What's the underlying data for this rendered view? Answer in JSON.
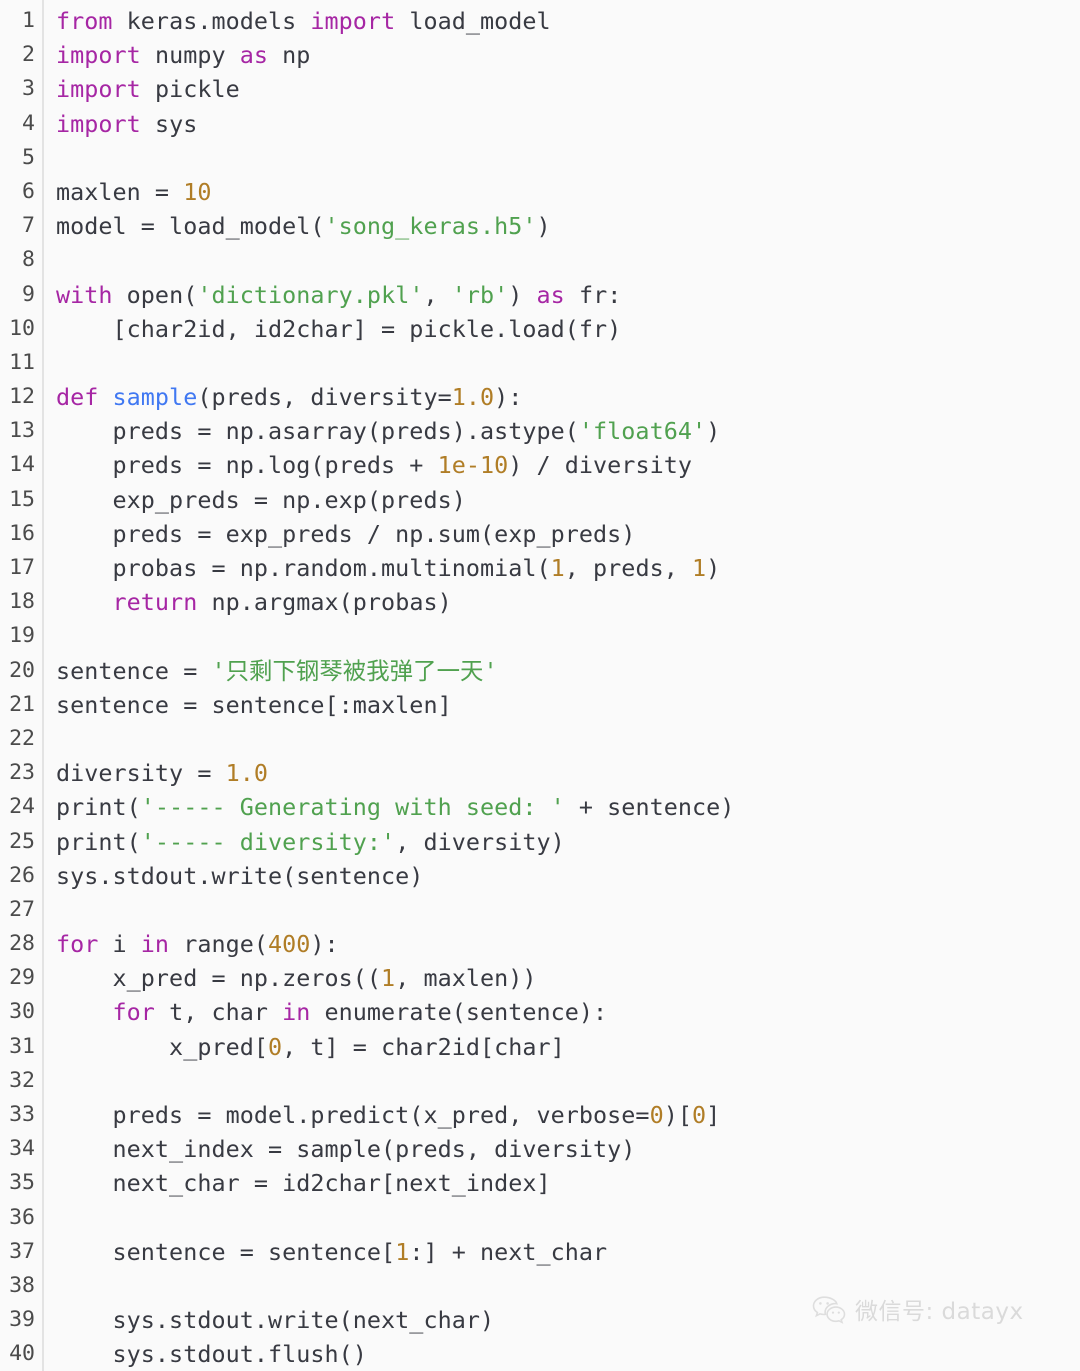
{
  "editor": {
    "language": "python",
    "background_color": "#fafafa",
    "gutter_color": "#4b4b4b",
    "text_color": "#383a42",
    "keyword_color": "#a626a4",
    "string_color": "#50a14f",
    "number_color": "#b07d26",
    "function_color": "#4078f2",
    "first_line_number": 1,
    "last_line_number": 40,
    "line_numbers": [
      "1",
      "2",
      "3",
      "4",
      "5",
      "6",
      "7",
      "8",
      "9",
      "10",
      "11",
      "12",
      "13",
      "14",
      "15",
      "16",
      "17",
      "18",
      "19",
      "20",
      "21",
      "22",
      "23",
      "24",
      "25",
      "26",
      "27",
      "28",
      "29",
      "30",
      "31",
      "32",
      "33",
      "34",
      "35",
      "36",
      "37",
      "38",
      "39",
      "40"
    ],
    "lines": [
      {
        "n": "1",
        "tokens": [
          {
            "t": "from ",
            "c": "kw"
          },
          {
            "t": "keras.models ",
            "c": "pl"
          },
          {
            "t": "import ",
            "c": "kw"
          },
          {
            "t": "load_model",
            "c": "pl"
          }
        ]
      },
      {
        "n": "2",
        "tokens": [
          {
            "t": "import ",
            "c": "kw"
          },
          {
            "t": "numpy ",
            "c": "pl"
          },
          {
            "t": "as ",
            "c": "kw"
          },
          {
            "t": "np",
            "c": "pl"
          }
        ]
      },
      {
        "n": "3",
        "tokens": [
          {
            "t": "import ",
            "c": "kw"
          },
          {
            "t": "pickle",
            "c": "pl"
          }
        ]
      },
      {
        "n": "4",
        "tokens": [
          {
            "t": "import ",
            "c": "kw"
          },
          {
            "t": "sys",
            "c": "pl"
          }
        ]
      },
      {
        "n": "5",
        "tokens": [
          {
            "t": "",
            "c": "pl"
          }
        ]
      },
      {
        "n": "6",
        "tokens": [
          {
            "t": "maxlen = ",
            "c": "pl"
          },
          {
            "t": "10",
            "c": "num"
          }
        ]
      },
      {
        "n": "7",
        "tokens": [
          {
            "t": "model = load_model(",
            "c": "pl"
          },
          {
            "t": "'song_keras.h5'",
            "c": "str"
          },
          {
            "t": ")",
            "c": "pl"
          }
        ]
      },
      {
        "n": "8",
        "tokens": [
          {
            "t": "",
            "c": "pl"
          }
        ]
      },
      {
        "n": "9",
        "tokens": [
          {
            "t": "with ",
            "c": "kw"
          },
          {
            "t": "open(",
            "c": "pl"
          },
          {
            "t": "'dictionary.pkl'",
            "c": "str"
          },
          {
            "t": ", ",
            "c": "pl"
          },
          {
            "t": "'rb'",
            "c": "str"
          },
          {
            "t": ") ",
            "c": "pl"
          },
          {
            "t": "as ",
            "c": "kw"
          },
          {
            "t": "fr:",
            "c": "pl"
          }
        ]
      },
      {
        "n": "10",
        "tokens": [
          {
            "t": "    [char2id, id2char] = pickle.load(fr)",
            "c": "pl"
          }
        ]
      },
      {
        "n": "11",
        "tokens": [
          {
            "t": "",
            "c": "pl"
          }
        ]
      },
      {
        "n": "12",
        "tokens": [
          {
            "t": "def ",
            "c": "kw"
          },
          {
            "t": "sample",
            "c": "fn"
          },
          {
            "t": "(preds, diversity=",
            "c": "pl"
          },
          {
            "t": "1.0",
            "c": "num"
          },
          {
            "t": "):",
            "c": "pl"
          }
        ]
      },
      {
        "n": "13",
        "tokens": [
          {
            "t": "    preds = np.asarray(preds).astype(",
            "c": "pl"
          },
          {
            "t": "'float64'",
            "c": "str"
          },
          {
            "t": ")",
            "c": "pl"
          }
        ]
      },
      {
        "n": "14",
        "tokens": [
          {
            "t": "    preds = np.log(preds + ",
            "c": "pl"
          },
          {
            "t": "1e-10",
            "c": "num"
          },
          {
            "t": ") / diversity",
            "c": "pl"
          }
        ]
      },
      {
        "n": "15",
        "tokens": [
          {
            "t": "    exp_preds = np.exp(preds)",
            "c": "pl"
          }
        ]
      },
      {
        "n": "16",
        "tokens": [
          {
            "t": "    preds = exp_preds / np.sum(exp_preds)",
            "c": "pl"
          }
        ]
      },
      {
        "n": "17",
        "tokens": [
          {
            "t": "    probas = np.random.multinomial(",
            "c": "pl"
          },
          {
            "t": "1",
            "c": "num"
          },
          {
            "t": ", preds, ",
            "c": "pl"
          },
          {
            "t": "1",
            "c": "num"
          },
          {
            "t": ")",
            "c": "pl"
          }
        ]
      },
      {
        "n": "18",
        "tokens": [
          {
            "t": "    ",
            "c": "pl"
          },
          {
            "t": "return ",
            "c": "kw"
          },
          {
            "t": "np.argmax(probas)",
            "c": "pl"
          }
        ]
      },
      {
        "n": "19",
        "tokens": [
          {
            "t": "",
            "c": "pl"
          }
        ]
      },
      {
        "n": "20",
        "tokens": [
          {
            "t": "sentence = ",
            "c": "pl"
          },
          {
            "t": "'只剩下钢琴被我弹了一天'",
            "c": "str"
          }
        ]
      },
      {
        "n": "21",
        "tokens": [
          {
            "t": "sentence = sentence[:maxlen]",
            "c": "pl"
          }
        ]
      },
      {
        "n": "22",
        "tokens": [
          {
            "t": "",
            "c": "pl"
          }
        ]
      },
      {
        "n": "23",
        "tokens": [
          {
            "t": "diversity = ",
            "c": "pl"
          },
          {
            "t": "1.0",
            "c": "num"
          }
        ]
      },
      {
        "n": "24",
        "tokens": [
          {
            "t": "print(",
            "c": "pl"
          },
          {
            "t": "'----- Generating with seed: '",
            "c": "str"
          },
          {
            "t": " + sentence)",
            "c": "pl"
          }
        ]
      },
      {
        "n": "25",
        "tokens": [
          {
            "t": "print(",
            "c": "pl"
          },
          {
            "t": "'----- diversity:'",
            "c": "str"
          },
          {
            "t": ", diversity)",
            "c": "pl"
          }
        ]
      },
      {
        "n": "26",
        "tokens": [
          {
            "t": "sys.stdout.write(sentence)",
            "c": "pl"
          }
        ]
      },
      {
        "n": "27",
        "tokens": [
          {
            "t": "",
            "c": "pl"
          }
        ]
      },
      {
        "n": "28",
        "tokens": [
          {
            "t": "for ",
            "c": "kw"
          },
          {
            "t": "i ",
            "c": "pl"
          },
          {
            "t": "in ",
            "c": "kw"
          },
          {
            "t": "range(",
            "c": "pl"
          },
          {
            "t": "400",
            "c": "num"
          },
          {
            "t": "):",
            "c": "pl"
          }
        ]
      },
      {
        "n": "29",
        "tokens": [
          {
            "t": "    x_pred = np.zeros((",
            "c": "pl"
          },
          {
            "t": "1",
            "c": "num"
          },
          {
            "t": ", maxlen))",
            "c": "pl"
          }
        ]
      },
      {
        "n": "30",
        "tokens": [
          {
            "t": "    ",
            "c": "pl"
          },
          {
            "t": "for ",
            "c": "kw"
          },
          {
            "t": "t, char ",
            "c": "pl"
          },
          {
            "t": "in ",
            "c": "kw"
          },
          {
            "t": "enumerate(sentence):",
            "c": "pl"
          }
        ]
      },
      {
        "n": "31",
        "tokens": [
          {
            "t": "        x_pred[",
            "c": "pl"
          },
          {
            "t": "0",
            "c": "num"
          },
          {
            "t": ", t] = char2id[char]",
            "c": "pl"
          }
        ]
      },
      {
        "n": "32",
        "tokens": [
          {
            "t": "",
            "c": "pl"
          }
        ]
      },
      {
        "n": "33",
        "tokens": [
          {
            "t": "    preds = model.predict(x_pred, verbose=",
            "c": "pl"
          },
          {
            "t": "0",
            "c": "num"
          },
          {
            "t": ")[",
            "c": "pl"
          },
          {
            "t": "0",
            "c": "num"
          },
          {
            "t": "]",
            "c": "pl"
          }
        ]
      },
      {
        "n": "34",
        "tokens": [
          {
            "t": "    next_index = sample(preds, diversity)",
            "c": "pl"
          }
        ]
      },
      {
        "n": "35",
        "tokens": [
          {
            "t": "    next_char = id2char[next_index]",
            "c": "pl"
          }
        ]
      },
      {
        "n": "36",
        "tokens": [
          {
            "t": "",
            "c": "pl"
          }
        ]
      },
      {
        "n": "37",
        "tokens": [
          {
            "t": "    sentence = sentence[",
            "c": "pl"
          },
          {
            "t": "1",
            "c": "num"
          },
          {
            "t": ":] + next_char",
            "c": "pl"
          }
        ]
      },
      {
        "n": "38",
        "tokens": [
          {
            "t": "",
            "c": "pl"
          }
        ]
      },
      {
        "n": "39",
        "tokens": [
          {
            "t": "    sys.stdout.write(next_char)",
            "c": "pl"
          }
        ]
      },
      {
        "n": "40",
        "tokens": [
          {
            "t": "    sys.stdout.flush()",
            "c": "pl"
          }
        ]
      }
    ]
  },
  "watermark": {
    "icon": "wechat-icon",
    "text": "微信号: datayx",
    "color": "#dadada"
  }
}
